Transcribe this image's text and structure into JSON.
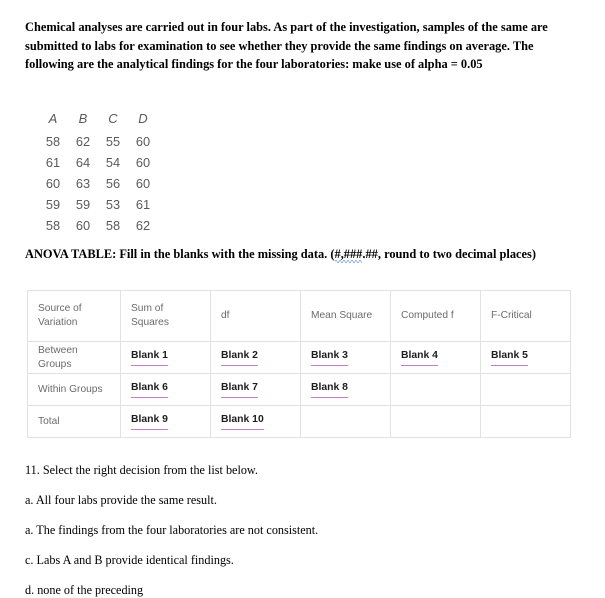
{
  "document": {
    "intro_prompt": "Chemical analyses are carried out in four labs. As part of the investigation, samples of the same are submitted to labs for examination to see whether they provide the same findings on average. The following are the analytical findings for the four laboratories: make use of alpha = 0.05",
    "anova_instruction_before": "ANOVA TABLE: Fill in the blanks with the missing data. (",
    "anova_instruction_flagged": "#,###",
    "anova_instruction_after": ".##, round to two decimal places)"
  },
  "data_matrix": {
    "headers": [
      "A",
      "B",
      "C",
      "D"
    ],
    "rows": [
      [
        "58",
        "62",
        "55",
        "60"
      ],
      [
        "61",
        "64",
        "54",
        "60"
      ],
      [
        "60",
        "63",
        "56",
        "60"
      ],
      [
        "59",
        "59",
        "53",
        "61"
      ],
      [
        "58",
        "60",
        "58",
        "62"
      ]
    ]
  },
  "anova_table": {
    "columns": [
      "Source of Variation",
      "Sum of Squares",
      "df",
      "Mean Square",
      "Computed f",
      "F-Critical"
    ],
    "rows": [
      {
        "source": "Between Groups",
        "sum_of_squares": "Blank 1",
        "df": "Blank 2",
        "mean_square": "Blank 3",
        "computed_f": "Blank 4",
        "f_critical": "Blank 5"
      },
      {
        "source": "Within Groups",
        "sum_of_squares": "Blank 6",
        "df": "Blank 7",
        "mean_square": "Blank 8",
        "computed_f": "",
        "f_critical": ""
      },
      {
        "source": "Total",
        "sum_of_squares": "Blank 9",
        "df": "Blank 10",
        "mean_square": "",
        "computed_f": "",
        "f_critical": ""
      }
    ]
  },
  "question": {
    "prompt": "11. Select the right decision from the list below.",
    "options": [
      "a. All four labs provide the same result.",
      "a. The findings from the four laboratories are not consistent.",
      "c. Labs A and B provide identical findings.",
      "d. none of the preceding"
    ]
  },
  "colors": {
    "blank_underline": "#c77acb",
    "table_border": "#e2e2e2",
    "table_text": "#6b6b6b",
    "matrix_text": "#5a5a5a",
    "spellcheck_underline": "#2b6fd4"
  }
}
